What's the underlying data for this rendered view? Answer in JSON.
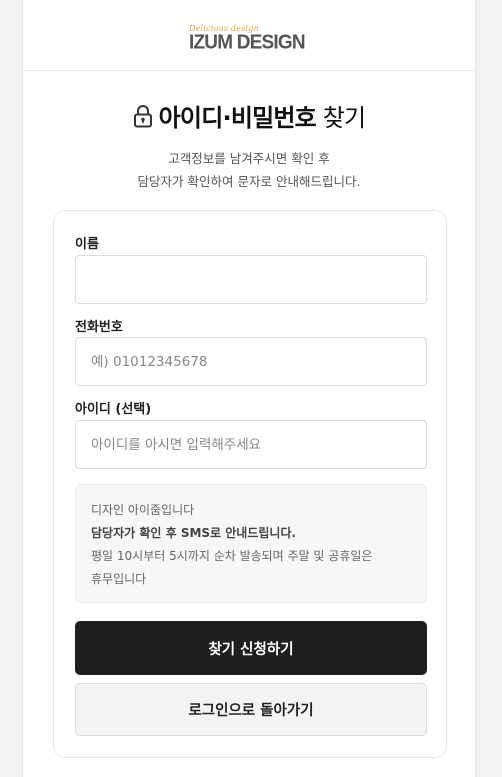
{
  "header": {
    "logo_script": "Delicious design",
    "logo_main": "IZUM DESIGN"
  },
  "title": {
    "icon": "lock-icon",
    "text_bold": "아이디·비밀번호",
    "text_regular": " 찾기"
  },
  "subtitle": {
    "line1": "고객정보를 남겨주시면 확인 후",
    "line2": "담당자가 확인하여 문자로 안내해드립니다."
  },
  "form": {
    "name": {
      "label": "이름",
      "value": "",
      "placeholder": ""
    },
    "phone": {
      "label": "전화번호",
      "value": "",
      "placeholder": "예) 01012345678"
    },
    "userid": {
      "label": "아이디 (선택)",
      "value": "",
      "placeholder": "아이디를 아시면 입력해주세요"
    }
  },
  "notice": {
    "line1": "디자인 아이줌입니다",
    "line2": "담당자가 확인 후 SMS로 안내드립니다.",
    "line3": "평일 10시부터 5시까지 순차 발송되며 주말 및 공휴일은",
    "line4": "휴무입니다"
  },
  "buttons": {
    "submit": "찾기 신청하기",
    "back": "로그인으로 돌아가기"
  },
  "colors": {
    "primary_button": "#1f1f1f",
    "logo_accent": "#e8a14a"
  }
}
